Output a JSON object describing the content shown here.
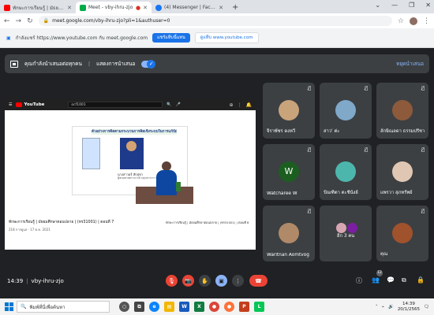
{
  "browser": {
    "tabs": [
      {
        "title": "ทักษะการเรียนรู้ | มัธยมศึกษาตอนปลาย",
        "color": "#ff0000",
        "active": false
      },
      {
        "title": "Meet - vby-ihru-zjo",
        "color": "#00ac47",
        "active": true
      },
      {
        "title": "(4) Messenger | Facebook",
        "color": "#1877f2",
        "active": false
      }
    ],
    "new_tab": "+",
    "url": "meet.google.com/vby-ihru-zjo?pli=1&authuser=0"
  },
  "infobar": {
    "text": "กำลังแชร์ https://www.youtube.com กับ meet.google.com",
    "share_this_tab": "แชร์แท็บนี้แทน",
    "switch_to": "ดูแท็บ www.youtube.com"
  },
  "meet": {
    "presenting_text": "คุณกำลังนำเสนอต่อทุกคน",
    "show_presentation": "แสดงการนำเสนอ",
    "stop_presenting": "หยุดนำเสนอ",
    "meeting_time": "14:39",
    "meeting_code": "vby-ihru-zjo",
    "people_badge": "12"
  },
  "shared": {
    "yt_logo": "YouTube",
    "yt_search": "ocf1001",
    "slide_title": "ตัวอย่างการคิดตามกระบวนการคิดเชิงระบบในการแก้ปัญหา",
    "slide_name": "นางสาวอร์ สักสุขา",
    "slide_sub": "ผู้ช่วยศาสตราจารย์ กลุ่มสาระการเรียนรู้การงาน",
    "video_title": "ทักษะการเรียนรู้ | มัธยมศึกษาตอนปลาย | (ทร31001) | ตอนที่ 7",
    "video_meta": "218 การดูแล · 17 ต.ค. 2021",
    "side_title": "ทักษะการเรียนรู้ | มัธยมศึกษาตอนปลาย | (ทร31001) | ตอนที่ 8"
  },
  "participants": [
    {
      "name": "จิราพัชร ดงหวี",
      "avatar_color": "#c9a37a"
    },
    {
      "name": "สาว' ต่ะ",
      "avatar_color": "#7fa8c9"
    },
    {
      "name": "ลักษิณลดา ธรรมปรีชา",
      "avatar_color": "#8d5a3b"
    },
    {
      "name": "Watcharee W",
      "letter": "W"
    },
    {
      "name": "ปัณฑิตา ตะชีนังย์",
      "avatar_color": "#4db6ac"
    },
    {
      "name": "แพรวา สุภทรัพย์",
      "avatar_color": "#e0c7b3"
    },
    {
      "name": "Waritnan Aomtvog",
      "avatar_color": "#b08968"
    },
    {
      "name": "อีก 3 คน"
    },
    {
      "name": "คุณ",
      "avatar_color": "#a0522d"
    }
  ],
  "taskbar": {
    "search_placeholder": "พิมพ์ที่นี่เพื่อค้นหา",
    "time": "14:39",
    "date": "20/1/2565"
  }
}
